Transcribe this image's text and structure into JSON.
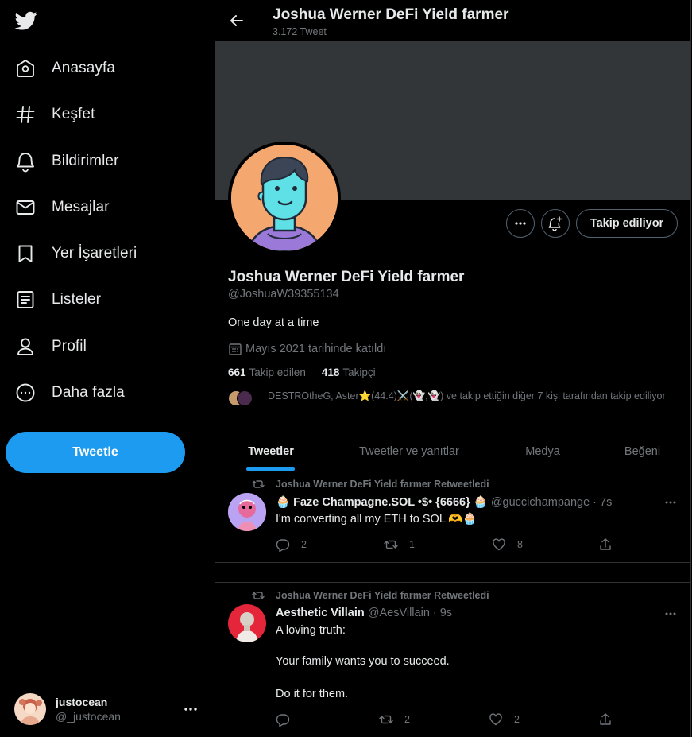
{
  "nav": {
    "items": [
      {
        "label": "Anasayfa",
        "icon": "home-icon"
      },
      {
        "label": "Keşfet",
        "icon": "hashtag-icon"
      },
      {
        "label": "Bildirimler",
        "icon": "bell-icon"
      },
      {
        "label": "Mesajlar",
        "icon": "mail-icon"
      },
      {
        "label": "Yer İşaretleri",
        "icon": "bookmark-icon"
      },
      {
        "label": "Listeler",
        "icon": "list-icon"
      },
      {
        "label": "Profil",
        "icon": "profile-icon"
      },
      {
        "label": "Daha fazla",
        "icon": "more-circle-icon"
      }
    ],
    "tweet_button": "Tweetle"
  },
  "account": {
    "display_name": "justocean",
    "handle": "@_justocean"
  },
  "header": {
    "title": "Joshua Werner DeFi Yield farmer",
    "tweet_count": "3.172 Tweet"
  },
  "profile": {
    "name": "Joshua Werner DeFi Yield farmer",
    "handle": "@JoshuaW39355134",
    "bio": "One day at a time",
    "joined": "Mayıs 2021 tarihinde katıldı",
    "following_count": "661",
    "following_label": "Takip edilen",
    "followers_count": "418",
    "followers_label": "Takipçi",
    "known_followers": "DESTROtheG, Aster⭐(44.4)⚔️(👻,👻) ve takip ettiğin diğer 7 kişi tarafından takip ediliyor",
    "follow_button": "Takip ediliyor"
  },
  "tabs": [
    "Tweetler",
    "Tweetler ve yanıtlar",
    "Medya",
    "Beğeni"
  ],
  "tweets": [
    {
      "retweet_label": "Joshua Werner DeFi Yield farmer Retweetledi",
      "author": "🧁 Faze Champagne.SOL •$• {6666} 🧁",
      "handle": "@guccichampange",
      "time": "· 7s",
      "text": "I'm converting all my ETH to SOL 🫶🧁",
      "replies": "2",
      "retweets": "1",
      "likes": "8"
    },
    {
      "retweet_label": "Joshua Werner DeFi Yield farmer Retweetledi",
      "author": "Aesthetic Villain",
      "handle": "@AesVillain",
      "time": "· 9s",
      "text_lines": [
        "A loving truth:",
        "Your family wants you to succeed.",
        "Do it for them."
      ],
      "replies": "",
      "retweets": "2",
      "likes": "2"
    }
  ],
  "colors": {
    "accent": "#1d9bf0",
    "background": "#000000",
    "banner": "#333639",
    "secondary_text": "#71767b"
  }
}
